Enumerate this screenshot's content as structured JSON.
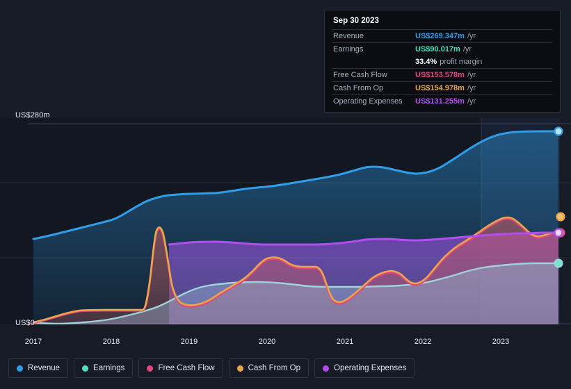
{
  "axis": {
    "y_top_label": "US$280m",
    "y_zero_label": "US$0",
    "y_max": 280,
    "y_min": 0,
    "x_ticks": [
      "2017",
      "2018",
      "2019",
      "2020",
      "2021",
      "2022",
      "2023"
    ]
  },
  "tooltip": {
    "date": "Sep 30 2023",
    "rows": [
      {
        "name": "Revenue",
        "value": "US$269.347m",
        "unit": "/yr",
        "color": "#2f9ee8"
      },
      {
        "name": "Earnings",
        "value": "US$90.017m",
        "unit": "/yr",
        "color": "#3ee0bb"
      },
      {
        "name": "Free Cash Flow",
        "value": "US$153.578m",
        "unit": "/yr",
        "color": "#e4457f"
      },
      {
        "name": "Cash From Op",
        "value": "US$154.978m",
        "unit": "/yr",
        "color": "#e8a84a"
      },
      {
        "name": "Operating Expenses",
        "value": "US$131.255m",
        "unit": "/yr",
        "color": "#b44df0"
      }
    ],
    "profit_margin_value": "33.4%",
    "profit_margin_label": "profit margin"
  },
  "legend": {
    "items": [
      {
        "label": "Revenue",
        "color": "#2f9ee8"
      },
      {
        "label": "Earnings",
        "color": "#4fe0c0"
      },
      {
        "label": "Free Cash Flow",
        "color": "#e4457f"
      },
      {
        "label": "Cash From Op",
        "color": "#e8a84a"
      },
      {
        "label": "Operating Expenses",
        "color": "#b44df0"
      }
    ]
  },
  "chart_data": {
    "type": "area",
    "title": "",
    "xlabel": "",
    "ylabel": "US$m",
    "ylim": [
      0,
      280
    ],
    "xlim": [
      "2016-10",
      "2023-09"
    ],
    "grid": true,
    "legend_position": "bottom",
    "x_tick_labels": [
      "2017",
      "2018",
      "2019",
      "2020",
      "2021",
      "2022",
      "2023"
    ],
    "gridline_values": [
      280,
      210,
      70,
      0
    ],
    "series": [
      {
        "name": "Revenue",
        "color": "#2f9ee8",
        "end_value": 269.347,
        "x": [
          "2016-10",
          "2017-01",
          "2017-04",
          "2017-07",
          "2017-10",
          "2018-01",
          "2018-04",
          "2018-07",
          "2018-10",
          "2019-01",
          "2019-04",
          "2019-07",
          "2019-10",
          "2020-01",
          "2020-04",
          "2020-07",
          "2020-10",
          "2021-01",
          "2021-04",
          "2021-07",
          "2021-10",
          "2022-01",
          "2022-04",
          "2022-07",
          "2022-10",
          "2023-01",
          "2023-04",
          "2023-07",
          "2023-09"
        ],
        "values": [
          119,
          122,
          126,
          130,
          134,
          138,
          143,
          152,
          162,
          172,
          178,
          180,
          181,
          182,
          186,
          190,
          192,
          196,
          200,
          205,
          212,
          214,
          209,
          206,
          212,
          228,
          246,
          262,
          269.347
        ]
      },
      {
        "name": "Earnings",
        "color": "#4fe0c0",
        "end_value": 90.017,
        "x": [
          "2016-10",
          "2017-01",
          "2017-04",
          "2017-07",
          "2017-10",
          "2018-01",
          "2018-04",
          "2018-07",
          "2018-10",
          "2019-01",
          "2019-04",
          "2019-07",
          "2019-10",
          "2020-01",
          "2020-04",
          "2020-07",
          "2020-10",
          "2021-01",
          "2021-04",
          "2021-07",
          "2021-10",
          "2022-01",
          "2022-04",
          "2022-07",
          "2022-10",
          "2023-01",
          "2023-04",
          "2023-07",
          "2023-09"
        ],
        "values": [
          2,
          1,
          0.5,
          0.5,
          1,
          2,
          4,
          7,
          12,
          20,
          28,
          33,
          36,
          38,
          41,
          43,
          42,
          41,
          41,
          41,
          41,
          42,
          44,
          49,
          57,
          68,
          78,
          86,
          90.017
        ]
      },
      {
        "name": "Free Cash Flow",
        "color": "#e4457f",
        "end_value": 153.578,
        "x": [
          "2016-10",
          "2017-01",
          "2017-04",
          "2017-07",
          "2017-10",
          "2018-01",
          "2018-04",
          "2018-07",
          "2018-10",
          "2019-01",
          "2019-04",
          "2019-07",
          "2019-10",
          "2020-01",
          "2020-04",
          "2020-07",
          "2020-10",
          "2021-01",
          "2021-04",
          "2021-07",
          "2021-10",
          "2022-01",
          "2022-04",
          "2022-07",
          "2022-10",
          "2023-01",
          "2023-04",
          "2023-07",
          "2023-09"
        ],
        "values": [
          2,
          6,
          10,
          14,
          16,
          16,
          16,
          95,
          45,
          22,
          24,
          34,
          42,
          72,
          78,
          78,
          45,
          48,
          55,
          78,
          62,
          60,
          75,
          110,
          128,
          140,
          132,
          147,
          153.578
        ]
      },
      {
        "name": "Cash From Op",
        "color": "#e8a84a",
        "end_value": 154.978,
        "x": [
          "2016-10",
          "2017-01",
          "2017-04",
          "2017-07",
          "2017-10",
          "2018-01",
          "2018-04",
          "2018-07",
          "2018-10",
          "2019-01",
          "2019-04",
          "2019-07",
          "2019-10",
          "2020-01",
          "2020-04",
          "2020-07",
          "2020-10",
          "2021-01",
          "2021-04",
          "2021-07",
          "2021-10",
          "2022-01",
          "2022-04",
          "2022-07",
          "2022-10",
          "2023-01",
          "2023-04",
          "2023-07",
          "2023-09"
        ],
        "values": [
          2,
          7,
          11,
          15,
          17,
          17,
          17,
          97,
          47,
          23,
          25,
          36,
          44,
          74,
          80,
          80,
          47,
          50,
          57,
          80,
          64,
          62,
          77,
          112,
          130,
          142,
          134,
          149,
          154.978
        ]
      },
      {
        "name": "Operating Expenses",
        "color": "#b44df0",
        "end_value": 131.255,
        "x": [
          "2018-07",
          "2018-10",
          "2019-01",
          "2019-04",
          "2019-07",
          "2019-10",
          "2020-01",
          "2020-04",
          "2020-07",
          "2020-10",
          "2021-01",
          "2021-04",
          "2021-07",
          "2021-10",
          "2022-01",
          "2022-04",
          "2022-07",
          "2022-10",
          "2023-01",
          "2023-04",
          "2023-07",
          "2023-09"
        ],
        "values": [
          116,
          118,
          119,
          120,
          121,
          118,
          118,
          118,
          119,
          119,
          120,
          121,
          125,
          126,
          126,
          125,
          126,
          128,
          129,
          130,
          131,
          131.255
        ]
      }
    ]
  }
}
